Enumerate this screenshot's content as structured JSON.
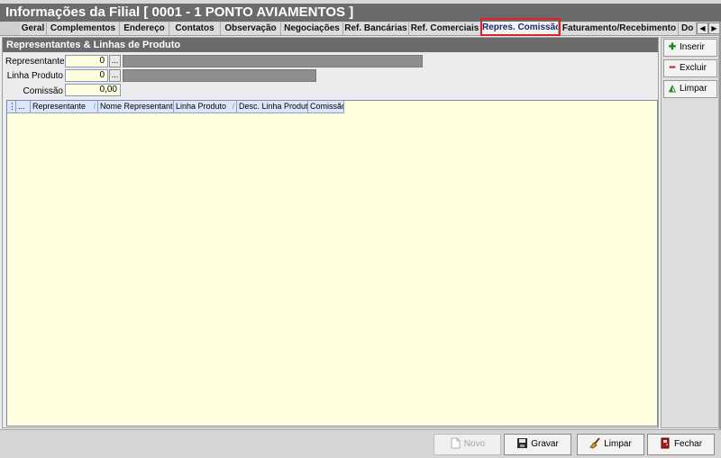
{
  "window": {
    "title": "Informações da Filial [ 0001 - 1 PONTO AVIAMENTOS ]"
  },
  "tabs": [
    {
      "label": "Geral",
      "active": false
    },
    {
      "label": "Complementos",
      "active": false
    },
    {
      "label": "Endereço",
      "active": false
    },
    {
      "label": "Contatos",
      "active": false
    },
    {
      "label": "Observação",
      "active": false
    },
    {
      "label": "Negociações",
      "active": false
    },
    {
      "label": "Ref. Bancárias",
      "active": false
    },
    {
      "label": "Ref. Comerciais",
      "active": false
    },
    {
      "label": "Repres. Comissão",
      "active": true
    },
    {
      "label": "Faturamento/Recebimento",
      "active": false
    },
    {
      "label": "Do",
      "active": false
    }
  ],
  "tab_scroll": {
    "left": "◀",
    "right": "▶"
  },
  "section": {
    "title": "Representantes & Linhas de Produto"
  },
  "form": {
    "representante": {
      "label": "Representante",
      "value": "0",
      "lookup": "..."
    },
    "linha_produto": {
      "label": "Linha Produto",
      "value": "0",
      "lookup": "..."
    },
    "comissao": {
      "label": "Comissão",
      "value": "0,00"
    }
  },
  "grid": {
    "indicator": "⋮",
    "columns": [
      {
        "label": "...",
        "sort": ""
      },
      {
        "label": "Representante",
        "sort": "/"
      },
      {
        "label": "Nome Representante",
        "sort": ""
      },
      {
        "label": "Linha Produto",
        "sort": "/"
      },
      {
        "label": "Desc. Linha Produto",
        "sort": ""
      },
      {
        "label": "Comissão",
        "sort": ""
      }
    ],
    "rows": []
  },
  "side_actions": {
    "inserir": "Inserir",
    "excluir": "Excluir",
    "limpar": "Limpar"
  },
  "footer_actions": {
    "novo": "Novo",
    "gravar": "Gravar",
    "limpar": "Limpar",
    "fechar": "Fechar"
  },
  "colors": {
    "accent_highlight": "#e0202a",
    "header_bg": "#6b6b6b",
    "grid_bg": "#ffffe0",
    "input_bg": "#fffde0"
  }
}
